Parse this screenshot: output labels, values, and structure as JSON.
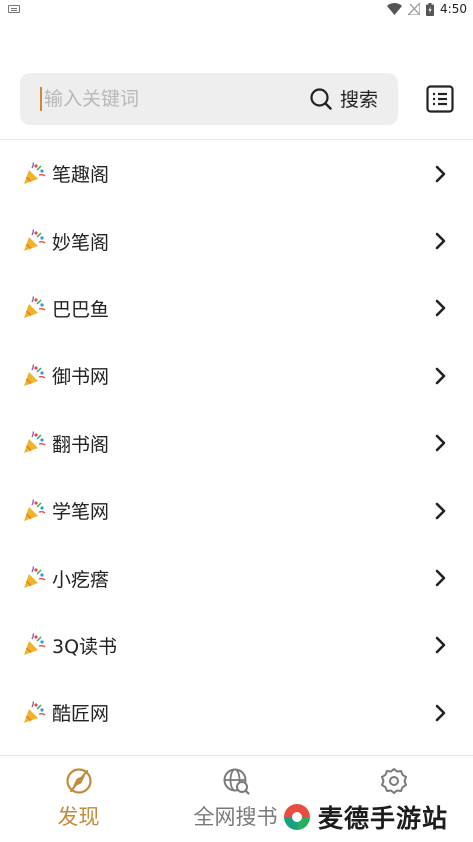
{
  "status_bar": {
    "time": "4:50"
  },
  "search": {
    "placeholder": "输入关键词",
    "button_label": "搜索"
  },
  "sources": [
    {
      "label": "笔趣阁"
    },
    {
      "label": "妙笔阁"
    },
    {
      "label": "巴巴鱼"
    },
    {
      "label": "御书网"
    },
    {
      "label": "翻书阁"
    },
    {
      "label": "学笔网"
    },
    {
      "label": "小疙瘩"
    },
    {
      "label": "3Q读书"
    },
    {
      "label": "酷匠网"
    }
  ],
  "tabs": [
    {
      "label": "发现",
      "icon": "compass-icon",
      "active": true
    },
    {
      "label": "全网搜书",
      "icon": "globe-search-icon",
      "active": false
    },
    {
      "label": "",
      "icon": "settings-icon",
      "active": false
    }
  ],
  "watermark": {
    "text": "麦德手游站"
  },
  "colors": {
    "accent": "#c48a3c",
    "search_bg": "#eeeeee",
    "inactive": "#7a7a7a"
  }
}
